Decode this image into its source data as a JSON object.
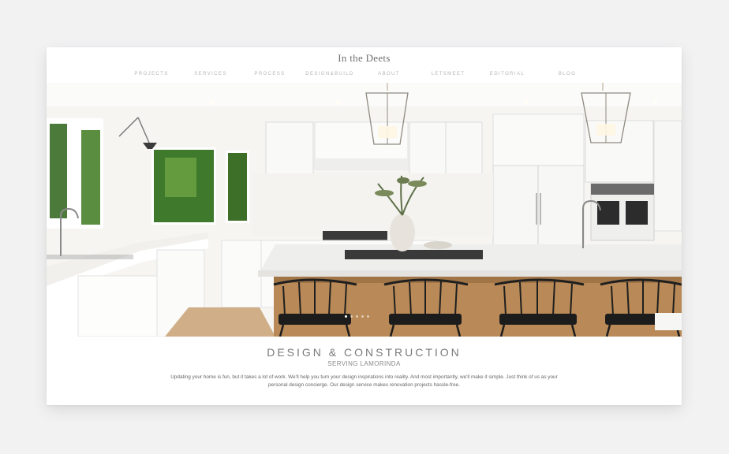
{
  "site": {
    "logo": "In the Deets"
  },
  "nav": {
    "items": [
      {
        "label": "PROJECTS"
      },
      {
        "label": "SERVICES"
      },
      {
        "label": "PROCESS"
      },
      {
        "label": "DESIGN&BUILD"
      },
      {
        "label": "ABOUT"
      },
      {
        "label": "LETSMEET"
      },
      {
        "label": "EDITORIAL"
      },
      {
        "label": "BLOG"
      }
    ]
  },
  "hero": {
    "image": "kitchen-photo",
    "slide_count": 5,
    "active_slide": 1
  },
  "caption": {
    "title": "DESIGN & CONSTRUCTION",
    "subtitle": "SERVING LAMORINDA",
    "body": "Updating your home is fun, but it takes a lot of work. We'll help you turn your design inspirations into reality. And most importantly, we'll make it simple. Just think of us as your personal design concierge. Our design service makes renovation projects hassle-free."
  },
  "colors": {
    "page_bg": "#f2f2f3",
    "nav_text": "#b5b5b5",
    "title_text": "#7a7a7a"
  }
}
